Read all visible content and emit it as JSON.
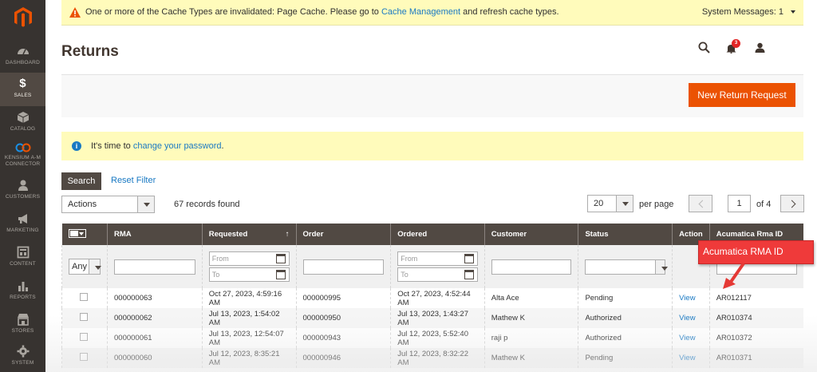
{
  "sidebar": {
    "items": [
      {
        "label": "DASHBOARD",
        "icon": "dashboard-icon"
      },
      {
        "label": "SALES",
        "icon": "dollar-icon"
      },
      {
        "label": "CATALOG",
        "icon": "cube-icon"
      },
      {
        "label_line1": "KENSIUM A-M",
        "label_line2": "CONNECTOR",
        "icon": "kensium-icon"
      },
      {
        "label": "CUSTOMERS",
        "icon": "customers-icon"
      },
      {
        "label": "MARKETING",
        "icon": "megaphone-icon"
      },
      {
        "label": "CONTENT",
        "icon": "content-icon"
      },
      {
        "label": "REPORTS",
        "icon": "bar-chart-icon"
      },
      {
        "label": "STORES",
        "icon": "store-icon"
      },
      {
        "label": "SYSTEM",
        "icon": "gear-icon"
      }
    ]
  },
  "system_message": {
    "text_before": "One or more of the Cache Types are invalidated: Page Cache. Please go to",
    "link": "Cache Management",
    "text_after": "and refresh cache types.",
    "counter": "System Messages: 1"
  },
  "header": {
    "title": "Returns",
    "notification_count": "3"
  },
  "actions": {
    "new_return": "New Return Request"
  },
  "notice": {
    "text": "It's time to",
    "link": "change your password",
    "end": "."
  },
  "toolbar": {
    "search": "Search",
    "reset": "Reset Filter",
    "actions_select": "Actions",
    "records": "67 records found",
    "per_page_value": "20",
    "per_page_label": "per page",
    "page": "1",
    "of_pages": "of 4"
  },
  "grid": {
    "columns": [
      "RMA",
      "Requested",
      "Order",
      "Ordered",
      "Customer",
      "Status",
      "Action",
      "Acumatica Rma ID"
    ],
    "filter": {
      "any": "Any",
      "from": "From",
      "to": "To"
    },
    "rows": [
      {
        "rma": "000000063",
        "requested": "Oct 27, 2023, 4:59:16 AM",
        "order": "000000995",
        "ordered": "Oct 27, 2023, 4:52:44 AM",
        "customer": "Alta Ace",
        "status": "Pending",
        "action": "View",
        "acumatica": "AR012117"
      },
      {
        "rma": "000000062",
        "requested": "Jul 13, 2023, 1:54:02 AM",
        "order": "000000950",
        "ordered": "Jul 13, 2023, 1:43:27 AM",
        "customer": "Mathew K",
        "status": "Authorized",
        "action": "View",
        "acumatica": "AR010374"
      },
      {
        "rma": "000000061",
        "requested": "Jul 13, 2023, 12:54:07 AM",
        "order": "000000943",
        "ordered": "Jul 12, 2023, 5:52:40 AM",
        "customer": "raji p",
        "status": "Authorized",
        "action": "View",
        "acumatica": "AR010372"
      },
      {
        "rma": "000000060",
        "requested": "Jul 12, 2023, 8:35:21 AM",
        "order": "000000946",
        "ordered": "Jul 12, 2023, 8:32:22 AM",
        "customer": "Mathew K",
        "status": "Pending",
        "action": "View",
        "acumatica": "AR010371"
      }
    ]
  },
  "callout": {
    "text": "Acumatica RMA ID"
  },
  "colors": {
    "brand_orange": "#eb5202",
    "sidebar_bg": "#373330",
    "header_bg": "#514943",
    "link": "#1979c3",
    "warning_bg": "#fffbbb",
    "callout_red": "#ef3a3a"
  }
}
